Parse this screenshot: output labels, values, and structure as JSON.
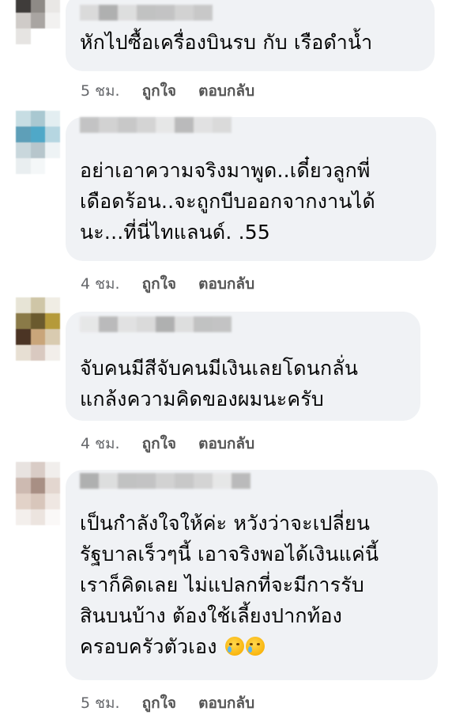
{
  "comments": [
    {
      "lines": [
        "หักไปซื้อเครื่องบินรบ กับ เรือดำน้ำ"
      ],
      "time": "5 ชม.",
      "like": "ถูกใจ",
      "reply": "ตอบกลับ",
      "avatar_colors": [
        "#b9b3ad",
        "#6f6a66",
        "#d8d5d2",
        "#3f3c3a",
        "#8e8a86",
        "#e9e7e5",
        "#cfcbc8",
        "#a9a5a2",
        "#f2f1f0",
        "#e6e4e2",
        "#ffffff",
        "#ffffff"
      ]
    },
    {
      "lines": [
        "อย่าเอาความจริงมาพูด..เดี๋ยวลูกพี่",
        "เดือดร้อน..จะถูกบีบออกจากงานได้",
        "นะ...ที่นี่ไทแลนด์. .55"
      ],
      "time": "4 ชม.",
      "like": "ถูกใจ",
      "reply": "ตอบกลับ",
      "avatar_colors": [
        "#c7dde3",
        "#a9c8d1",
        "#e3eef1",
        "#5e9fb8",
        "#4fa8c8",
        "#b6d6e1",
        "#c9d7dc",
        "#b7c6cc",
        "#eef3f5",
        "#e9eef0",
        "#f4f7f8",
        "#ffffff"
      ]
    },
    {
      "lines": [
        "จับคนมีสีจับคนมีเงินเลยโดนกลั่น",
        "แกล้งความคิดของผมนะครับ"
      ],
      "time": "4 ชม.",
      "like": "ถูกใจ",
      "reply": "ตอบกลับ",
      "avatar_colors": [
        "#e7e4d6",
        "#cfc6a7",
        "#f0ede4",
        "#8a7a48",
        "#6a5a2e",
        "#b59a3a",
        "#4b3424",
        "#c9a57a",
        "#d9cbb0",
        "#e7dfd3",
        "#d9c9c0",
        "#f2eeea"
      ]
    },
    {
      "lines": [
        "เป็นกำลังใจให้ค่ะ หวังว่าจะเปลี่ยน",
        "รัฐบาลเร็วๆนี้ เอาจริงพอได้เงินแค่นี้",
        "เราก็คิดเลย ไม่แปลกที่จะมีการรับ",
        "สินบนบ้าง ต้องใช้เลี้ยงปากท้อง",
        "ครอบครัวตัวเอง"
      ],
      "emojis": [
        "crying-face",
        "crying-face"
      ],
      "time": "5 ชม.",
      "like": "ถูกใจ",
      "reply": "ตอบกลับ",
      "avatar_colors": [
        "#e8e3e0",
        "#d9ccc6",
        "#f1eeec",
        "#cdbab1",
        "#a88f84",
        "#e3d6cf",
        "#e2d2c8",
        "#d8c6bb",
        "#efe7e2",
        "#f3efec",
        "#ece4df",
        "#faf8f7"
      ]
    }
  ],
  "name_blur_colors": [
    "#d8d8d8",
    "#bfbfbf",
    "#e6e6e6",
    "#a9a9a9",
    "#cfcfcf",
    "#b5b5b5",
    "#dcdcdc",
    "#c4c4c4",
    "#e0e0e0",
    "#bdbdbd",
    "#d1d1d1"
  ]
}
